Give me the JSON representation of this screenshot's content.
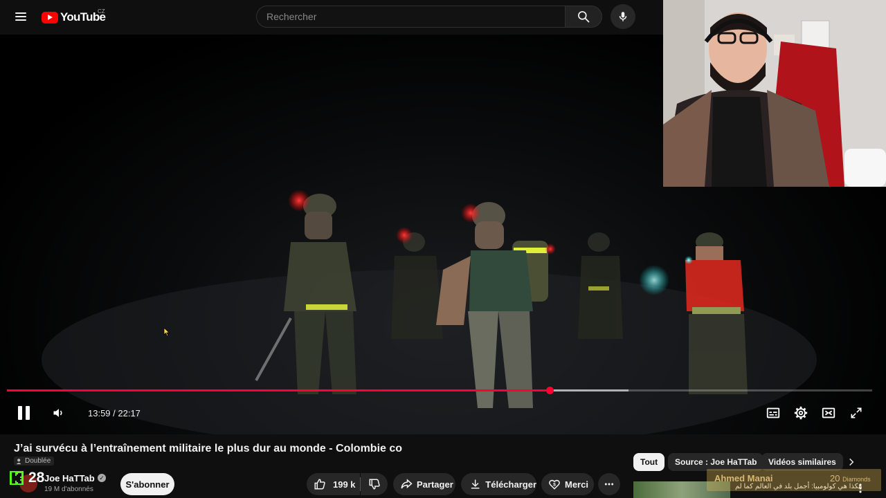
{
  "header": {
    "logo_text": "YouTube",
    "country_code": "CZ",
    "search_placeholder": "Rechercher"
  },
  "player": {
    "current_time": "13:59",
    "duration": "22:17",
    "time_label": "13:59 / 22:17",
    "progress_fraction": 0.627,
    "buffered_fraction": 0.718,
    "state": "playing",
    "accent_color": "#ff0033"
  },
  "video": {
    "title": "J’ai survécu à l’entraînement militaire le plus dur au monde - Colombie co",
    "dubbed_label": "Doublée"
  },
  "channel": {
    "kick_count": "28",
    "name": "Joe HaTTab",
    "subscribers": "19 M d'abonnés",
    "subscribe_label": "S'abonner"
  },
  "actions": {
    "likes": "199 k",
    "share": "Partager",
    "download": "Télécharger",
    "thanks": "Merci"
  },
  "chips": [
    "Tout",
    "Source : Joe HaTTab",
    "Vidéos similaires"
  ],
  "recommendation": {
    "title": "هكذا هي كولومبيا: أجمل بلد في العالم كما لم"
  },
  "donation": {
    "name": "Ahmed Manai",
    "amount": "20",
    "unit": "Diamonds",
    "message": "هكذا هي كولومبيا: أجمل بلد في العالم كما لم"
  },
  "icons": {
    "menu": "menu-icon",
    "search": "search-icon",
    "mic": "mic-icon",
    "pause": "pause-icon",
    "volume": "volume-icon",
    "subtitles": "subtitles-icon",
    "settings": "gear-icon",
    "miniplayer": "miniplayer-icon",
    "fullscreen": "fullscreen-icon",
    "like": "thumbs-up-icon",
    "dislike": "thumbs-down-icon",
    "share": "share-icon",
    "download": "download-icon",
    "thanks": "heart-dollar-icon",
    "more": "more-horizontal-icon",
    "verified": "verified-check-icon"
  }
}
